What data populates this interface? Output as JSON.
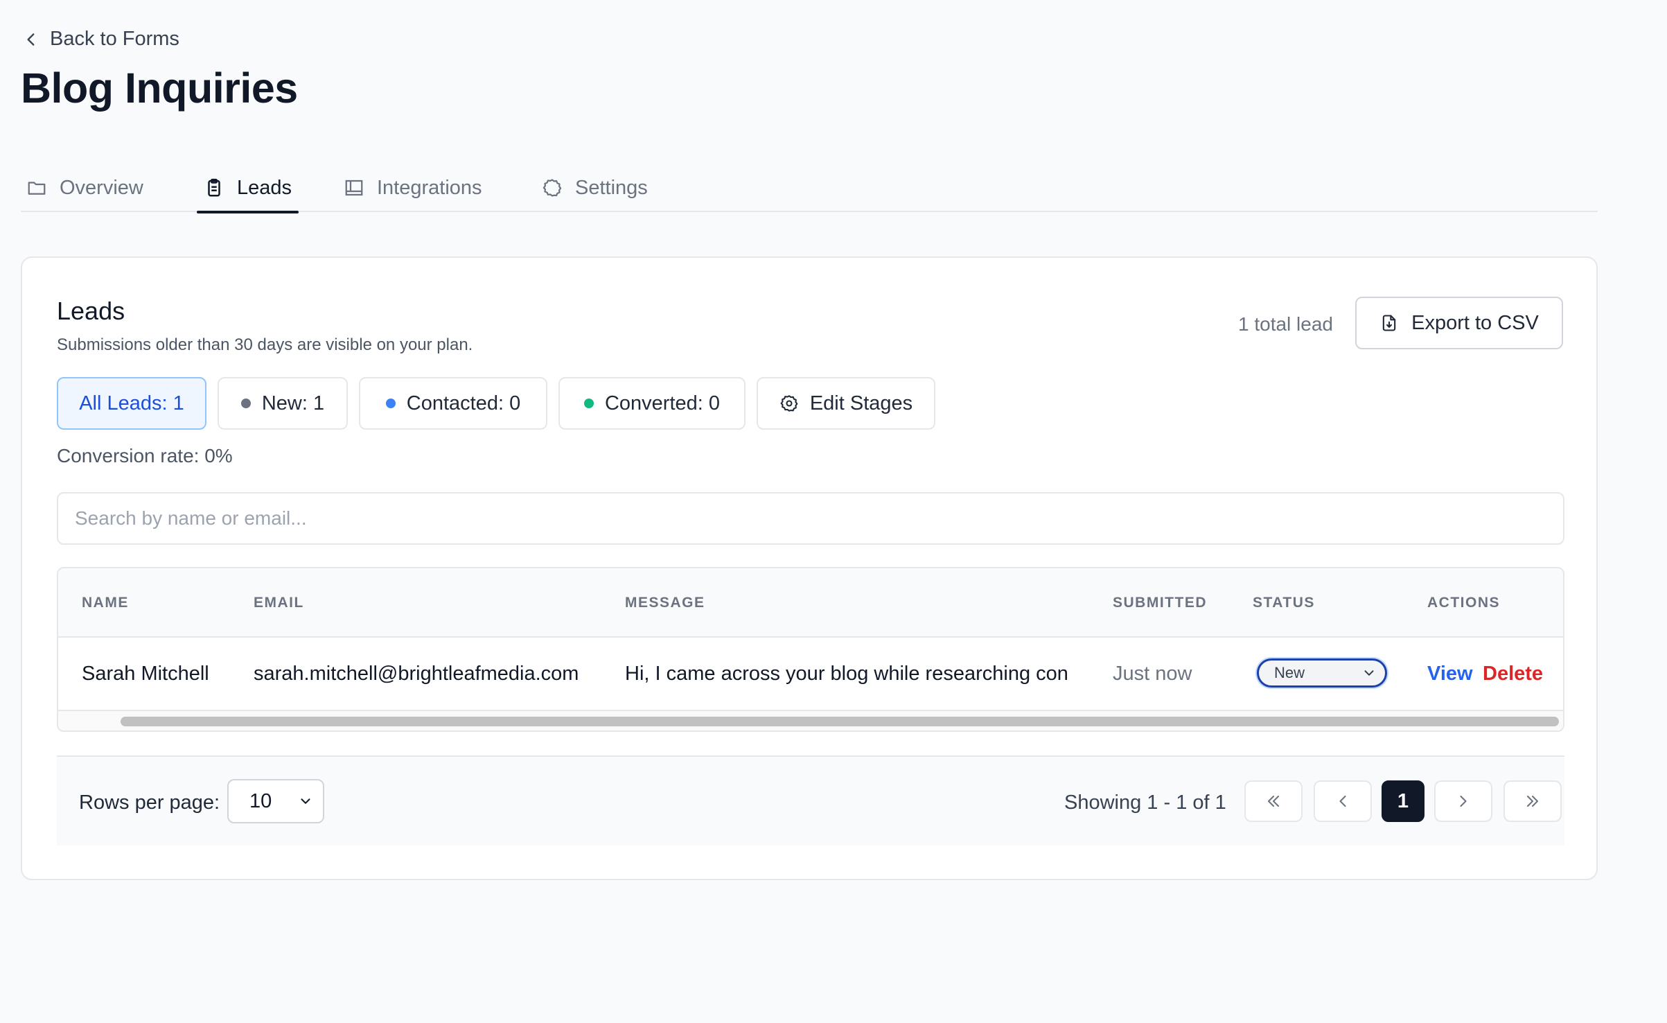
{
  "nav": {
    "back_label": "Back to Forms"
  },
  "page": {
    "title": "Blog Inquiries"
  },
  "tabs": [
    {
      "label": "Overview",
      "icon": "folder-icon"
    },
    {
      "label": "Leads",
      "icon": "clipboard-icon",
      "active": true
    },
    {
      "label": "Integrations",
      "icon": "layout-icon"
    },
    {
      "label": "Settings",
      "icon": "gear-icon"
    }
  ],
  "leads_card": {
    "title": "Leads",
    "subtitle": "Submissions older than 30 days are visible on your plan.",
    "total_label": "1 total lead",
    "export_label": "Export to CSV"
  },
  "filters": [
    {
      "label": "All Leads: 1",
      "active": true
    },
    {
      "label": "New: 1",
      "dot_color": "#6b7280"
    },
    {
      "label": "Contacted: 0",
      "dot_color": "#3b82f6"
    },
    {
      "label": "Converted: 0",
      "dot_color": "#10b981"
    },
    {
      "label": "Edit Stages",
      "icon": "gear-icon"
    }
  ],
  "conversion_rate": "Conversion rate: 0%",
  "search": {
    "placeholder": "Search by name or email...",
    "value": ""
  },
  "table": {
    "columns": [
      "NAME",
      "EMAIL",
      "MESSAGE",
      "SUBMITTED",
      "STATUS",
      "ACTIONS"
    ],
    "rows": [
      {
        "name": "Sarah Mitchell",
        "email": "sarah.mitchell@brightleafmedia.com",
        "message": "Hi, I came across your blog while researching con",
        "submitted": "Just now",
        "status": "New",
        "view_label": "View",
        "delete_label": "Delete"
      }
    ]
  },
  "pagination": {
    "rows_per_page_label": "Rows per page:",
    "rows_per_page_value": "10",
    "showing": "Showing 1 - 1 of 1",
    "current_page": "1"
  },
  "colors": {
    "accent": "#2563eb",
    "danger": "#dc2626",
    "dark": "#111827"
  }
}
